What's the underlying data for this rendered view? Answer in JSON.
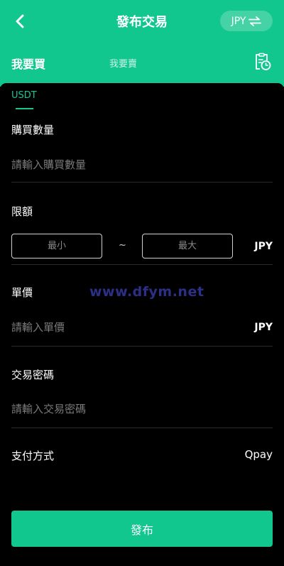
{
  "header": {
    "title": "發布交易",
    "currency": "JPY",
    "back_icon": "chevron-left-icon",
    "swap_icon": "swap-arrows-icon"
  },
  "tabs": {
    "buy": "我要買",
    "sell": "我要賣",
    "history_icon": "order-history-icon"
  },
  "coin": "USDT",
  "quantity": {
    "label": "購買數量",
    "placeholder": "請輸入購買數量"
  },
  "limit": {
    "label": "限額",
    "min_placeholder": "最小",
    "separator": "~",
    "max_placeholder": "最大",
    "unit": "JPY"
  },
  "price": {
    "label": "單價",
    "placeholder": "請輸入單價",
    "unit": "JPY"
  },
  "password": {
    "label": "交易密碼",
    "placeholder": "請輸入交易密碼"
  },
  "payment": {
    "label": "支付方式",
    "value": "Qpay"
  },
  "submit_label": "發布",
  "watermark": "www.dfym.net",
  "colors": {
    "accent": "#11c78e",
    "background": "#000000",
    "watermark": "#2c2f86"
  }
}
